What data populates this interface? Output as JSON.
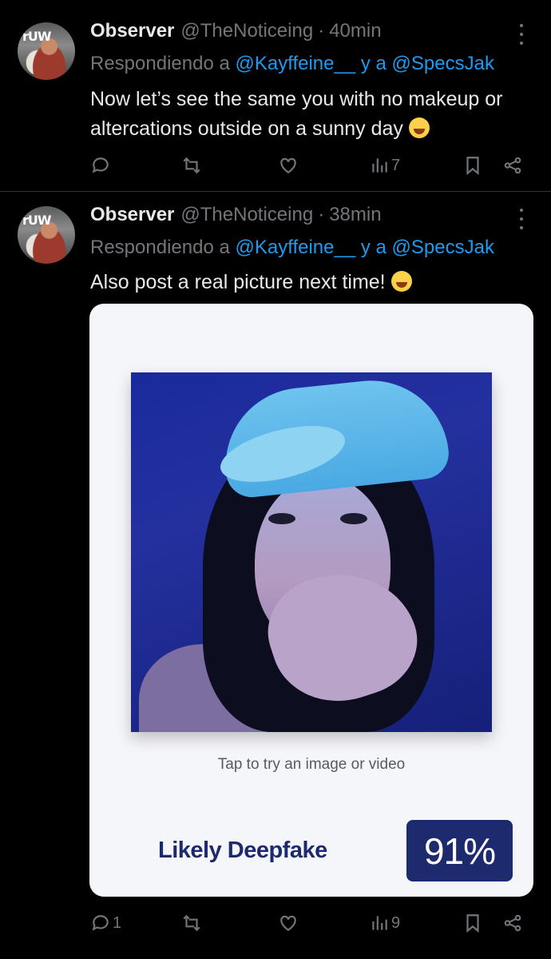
{
  "tweets": [
    {
      "author_name": "Observer",
      "handle": "@TheNoticeing",
      "separator": "·",
      "time": "40min",
      "reply_prefix": "Respondiendo a",
      "mention_1": "@Kayffeine__",
      "reply_join": "y a",
      "mention_2": "@SpecsJak",
      "text": "Now let’s see the same you with no makeup or altercations outside on a sunny day",
      "reply_count": "",
      "view_count": "7",
      "avatar_text": "rUW"
    },
    {
      "author_name": "Observer",
      "handle": "@TheNoticeing",
      "separator": "·",
      "time": "38min",
      "reply_prefix": "Respondiendo a",
      "mention_1": "@Kayffeine__",
      "reply_join": "y a",
      "mention_2": "@SpecsJak",
      "text": "Also post a real picture next time!",
      "reply_count": "1",
      "view_count": "9",
      "avatar_text": "rUW",
      "card": {
        "tap_text": "Tap to try an image or video",
        "verdict": "Likely Deepfake",
        "percent": "91%"
      }
    }
  ],
  "icons": {
    "reply": "reply-icon",
    "retweet": "retweet-icon",
    "like": "heart-icon",
    "views": "views-icon",
    "bookmark": "bookmark-icon",
    "share": "share-icon",
    "more": "more-icon"
  },
  "colors": {
    "background": "#000000",
    "text": "#e7e9ea",
    "muted": "#71767b",
    "link": "#1d9bf0",
    "card_bg": "#f5f6fa",
    "verdict": "#1e2a6e"
  }
}
